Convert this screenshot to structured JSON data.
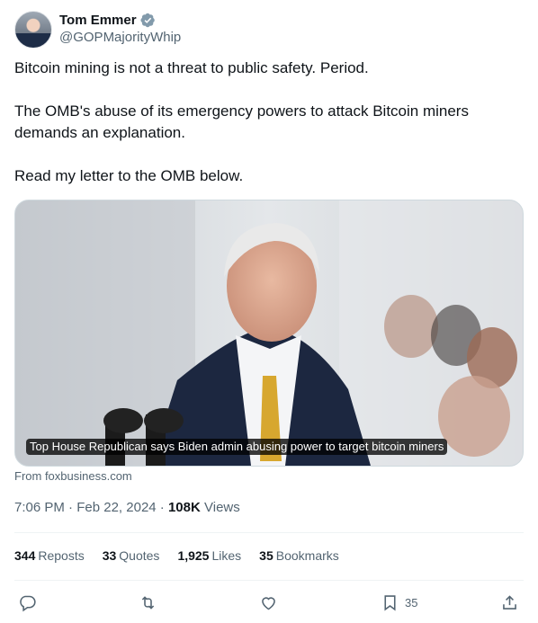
{
  "author": {
    "display_name": "Tom Emmer",
    "handle": "@GOPMajorityWhip",
    "verified": true
  },
  "tweet": {
    "lines": [
      "Bitcoin mining is not a threat to public safety. Period.",
      "The OMB's abuse of its emergency powers to attack Bitcoin miners demands an explanation.",
      "Read my letter to the OMB below."
    ]
  },
  "card": {
    "title": "Top House Republican says Biden admin abusing power to target bitcoin miners",
    "source": "From foxbusiness.com"
  },
  "meta": {
    "time": "7:06 PM",
    "date": "Feb 22, 2024",
    "separator": " · ",
    "views_count": "108K",
    "views_label": "Views"
  },
  "stats": [
    {
      "count": "344",
      "label": "Reposts"
    },
    {
      "count": "33",
      "label": "Quotes"
    },
    {
      "count": "1,925",
      "label": "Likes"
    },
    {
      "count": "35",
      "label": "Bookmarks"
    }
  ],
  "actions": {
    "bookmark_count": "35"
  },
  "colors": {
    "verified": "#1d9bf0",
    "secondary_text": "#536471"
  }
}
